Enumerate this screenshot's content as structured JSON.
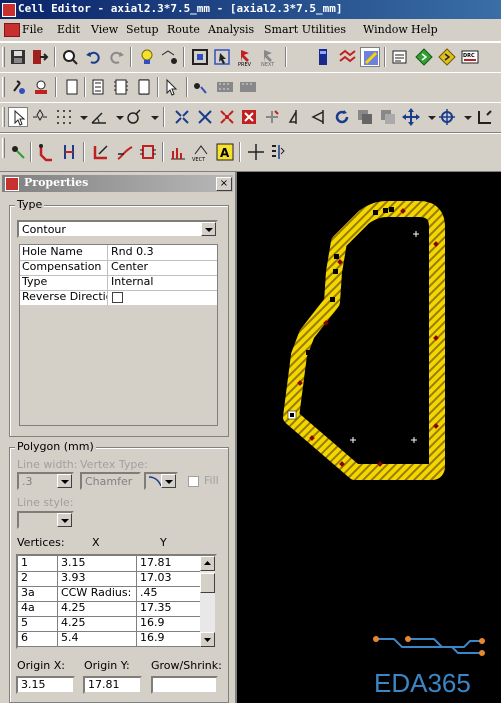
{
  "window": {
    "title": "Cell Editor - axial2.3*7.5_mm - [axial2.3*7.5_mm]"
  },
  "menu": [
    "File",
    "Edit",
    "View",
    "Setup",
    "Route",
    "Analysis",
    "Smart Utilities",
    "Window",
    "Help"
  ],
  "toolbar_icons": {
    "row1": [
      "save-icon",
      "exit-icon",
      "print-preview-icon",
      "undo-icon",
      "redo-icon",
      "highlight-icon",
      "select-net-icon",
      "fit-board-icon",
      "select-icon",
      "prev-icon",
      "next-icon",
      "layer-icon",
      "hatch-icon",
      "display-control-icon",
      "properties-icon",
      "add-via-icon",
      "drc-check-icon",
      "drc-icon"
    ],
    "row2": [
      "place-pin-icon",
      "place-part-icon",
      "copy-icon",
      "pin-array-icon",
      "pin-array2-icon",
      "pin-array3-icon",
      "cursor-icon",
      "group-icon",
      "group2-icon"
    ],
    "row3": [
      "select-arrow-icon",
      "select-area-icon",
      "grid-icon",
      "dimension-icon",
      "place-icon",
      "align-icon",
      "distribute-icon",
      "flip-icon",
      "move-icon",
      "snap-icon",
      "rotate-left-icon",
      "rotate-right-icon",
      "rotate-icon",
      "copy-block-icon",
      "stack-icon",
      "move-cross-icon",
      "target-icon"
    ],
    "row4": [
      "point-icon",
      "route-icon",
      "measure-icon",
      "route-angle-icon",
      "route-curve-icon",
      "component-icon",
      "chart-icon",
      "vector-icon",
      "text-icon",
      "crosshair-icon",
      "list-icon"
    ]
  },
  "panel": {
    "title": "Properties",
    "close": "×",
    "type_group": "Type",
    "type_value": "Contour",
    "props": [
      {
        "name": "Hole Name",
        "value": "Rnd 0.3"
      },
      {
        "name": "Compensation",
        "value": "Center"
      },
      {
        "name": "Type",
        "value": "Internal"
      },
      {
        "name": "Reverse Direction",
        "value": ""
      }
    ],
    "polygon_group": "Polygon (mm)",
    "line_width_label": "Line width:",
    "line_width_value": ".3",
    "vertex_type_label": "Vertex Type:",
    "vertex_type_value": "Chamfer",
    "fill_label": "Fill",
    "line_style_label": "Line style:",
    "vertices_label": "Vertices:",
    "col_x": "X",
    "col_y": "Y",
    "vertices": [
      [
        "1",
        "3.15",
        "17.81"
      ],
      [
        "2",
        "3.93",
        "17.03"
      ],
      [
        "3a",
        "CCW Radius:",
        ".45"
      ],
      [
        "4a",
        "4.25",
        "17.35"
      ],
      [
        "5",
        "4.25",
        "16.9"
      ],
      [
        "6",
        "5.4",
        "16.9"
      ]
    ],
    "origin_x_label": "Origin X:",
    "origin_x_value": "3.15",
    "origin_y_label": "Origin Y:",
    "origin_y_value": "17.81",
    "grow_shrink_label": "Grow/Shrink:",
    "grow_shrink_value": ""
  },
  "colors": {
    "contour_yellow": "#f2d800",
    "contour_hatch": "#9a7a00",
    "canvas": "#000000",
    "logo_blue": "#3a86c6",
    "logo_orange": "#e8882a"
  },
  "watermark": "EDA365"
}
